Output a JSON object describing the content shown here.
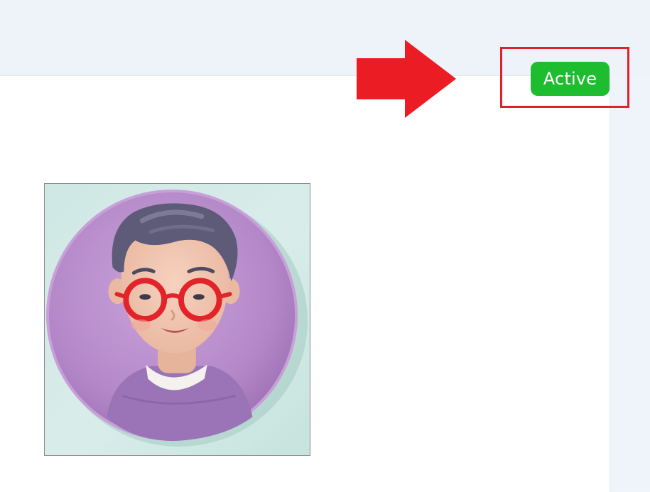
{
  "status": {
    "label": "Active",
    "color": "#1ebd2f"
  },
  "annotation": {
    "arrow_color": "#ec1c24",
    "highlight_color": "#e0202a"
  },
  "avatar": {
    "icon": "avatar-icon",
    "circle_color": "#b488c8",
    "glasses_color": "#e3232a"
  }
}
